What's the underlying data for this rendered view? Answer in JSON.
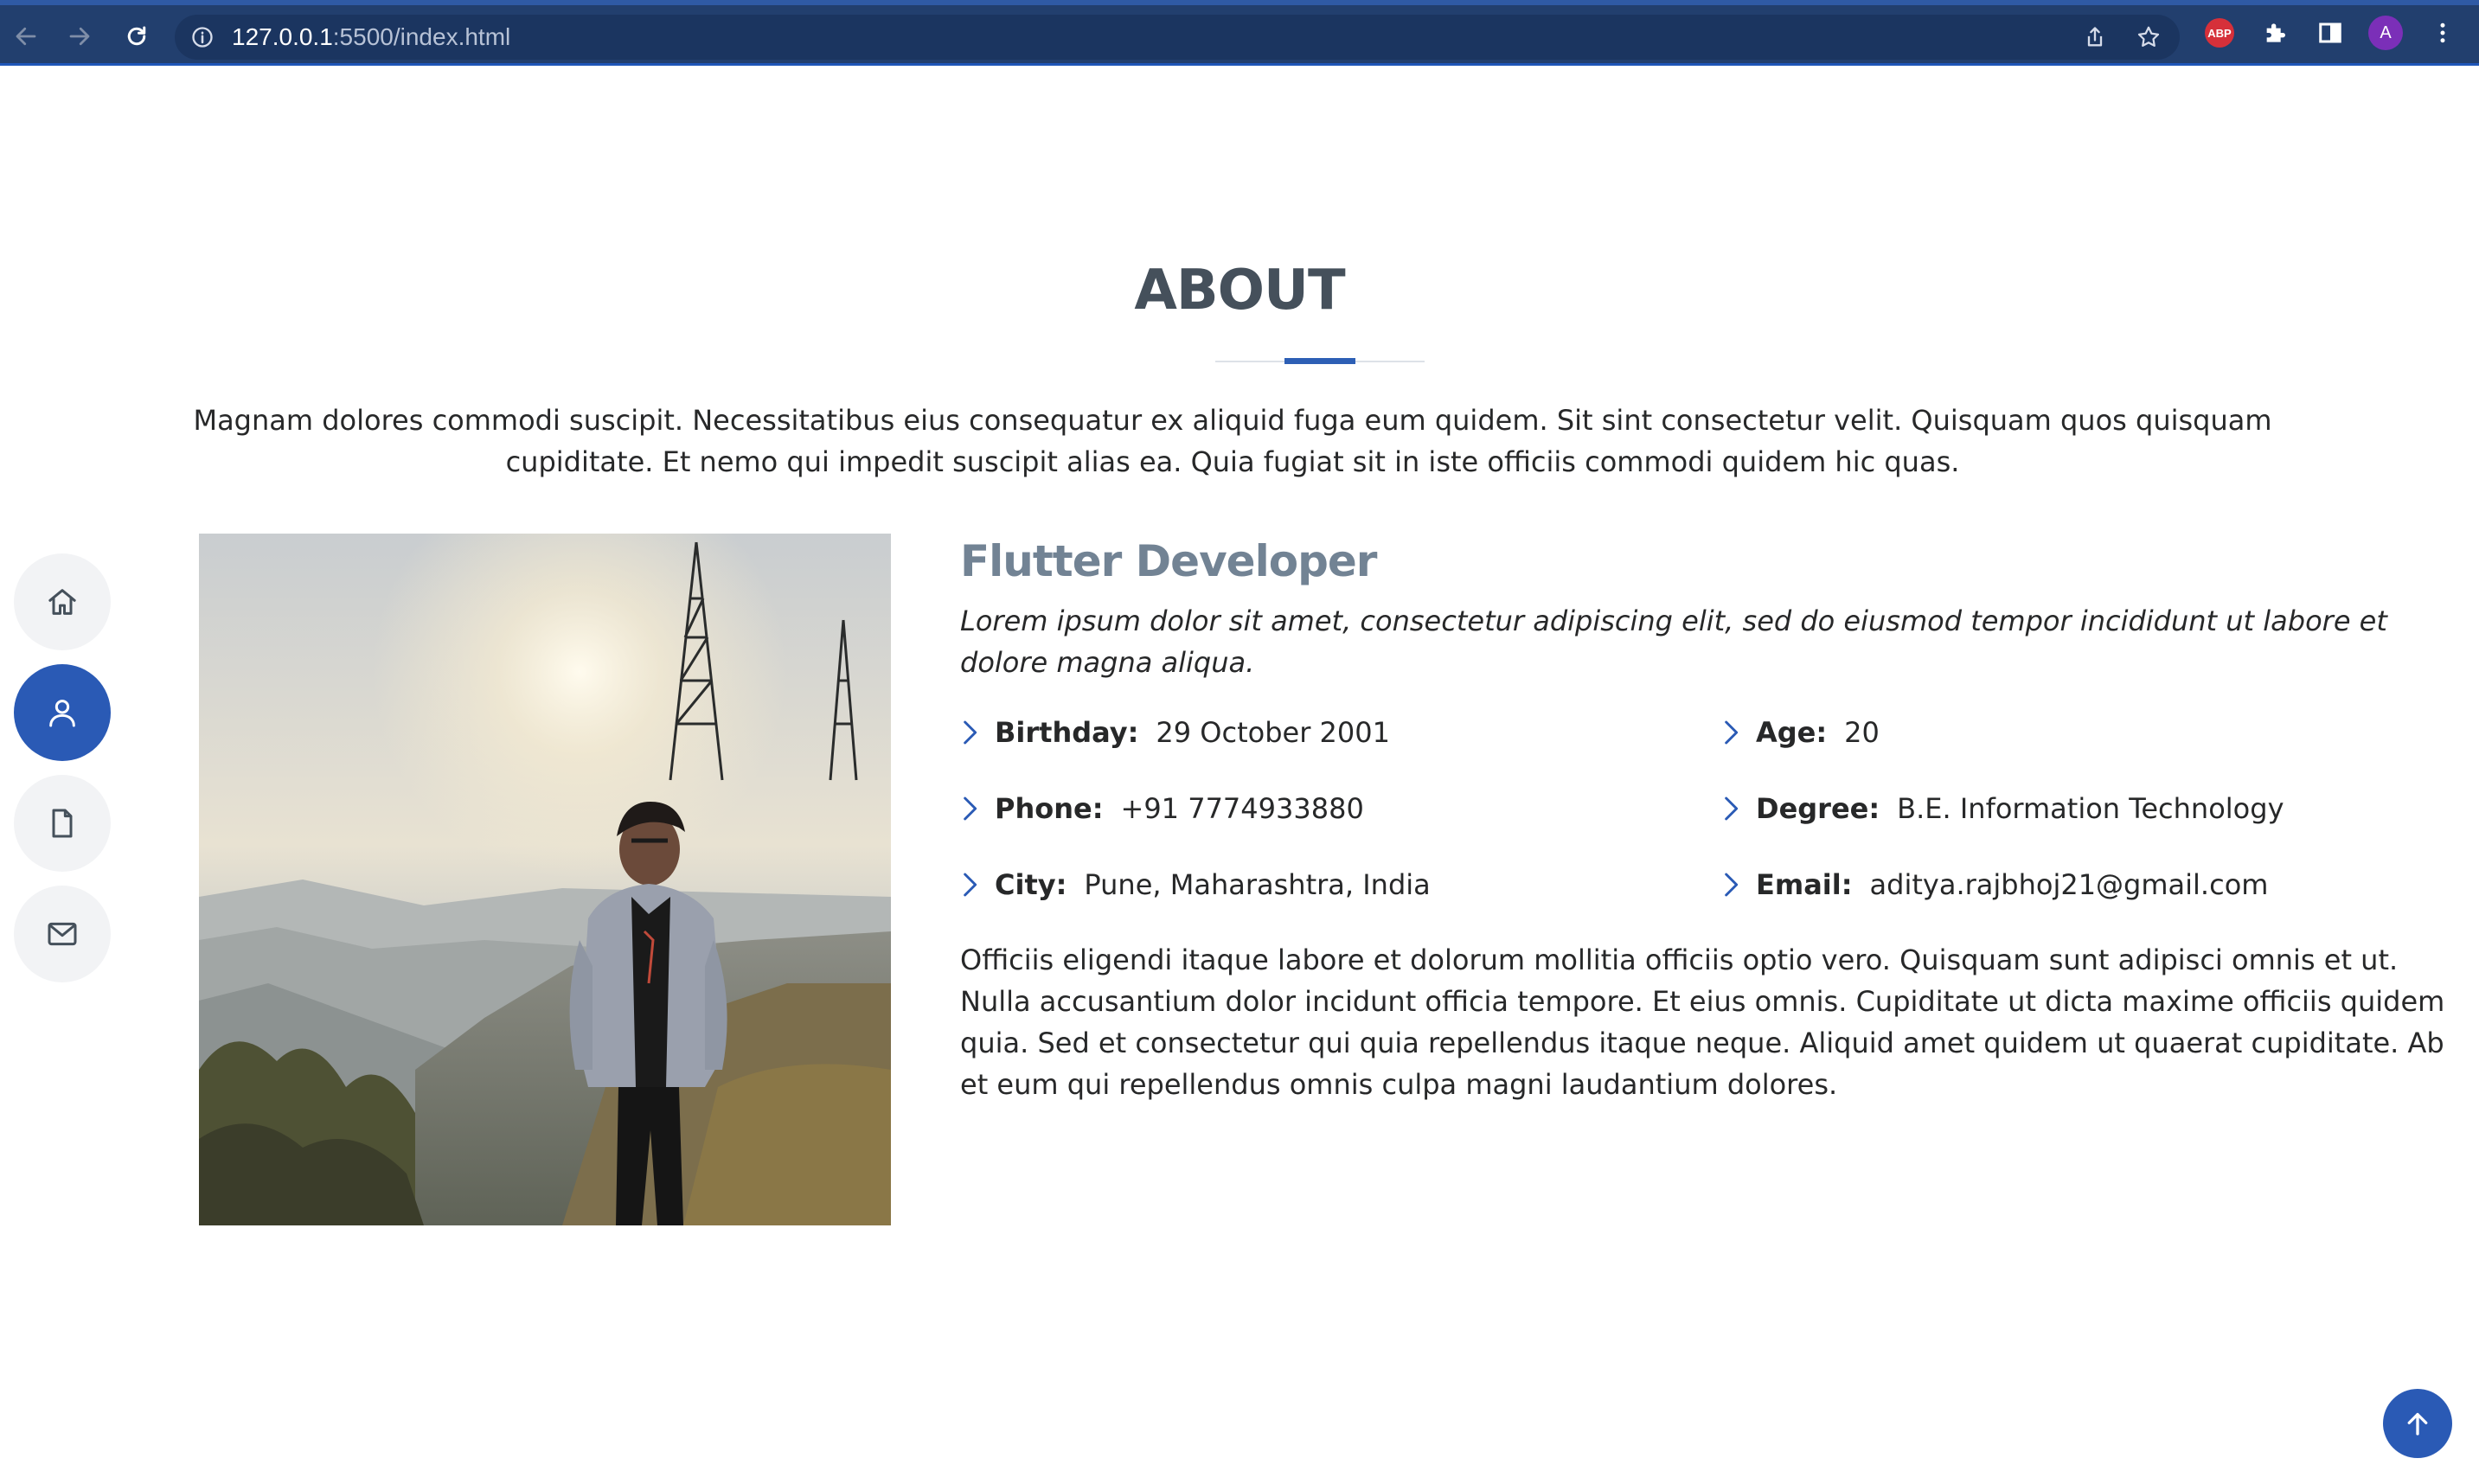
{
  "browser": {
    "url_host": "127.0.0.1",
    "url_rest": ":5500/index.html",
    "profile_initial": "A",
    "adblock_label": "ABP"
  },
  "section": {
    "title": "ABOUT",
    "intro": "Magnam dolores commodi suscipit. Necessitatibus eius consequatur ex aliquid fuga eum quidem. Sit sint consectetur velit. Quisquam quos quisquam cupiditate. Et nemo qui impedit suscipit alias ea. Quia fugiat sit in iste officiis commodi quidem hic quas."
  },
  "sidenav": {
    "items": [
      {
        "icon": "home-icon",
        "active": false
      },
      {
        "icon": "user-icon",
        "active": true
      },
      {
        "icon": "file-icon",
        "active": false
      },
      {
        "icon": "mail-icon",
        "active": false
      }
    ]
  },
  "profile": {
    "role": "Flutter Developer",
    "tagline": "Lorem ipsum dolor sit amet, consectetur adipiscing elit, sed do eiusmod tempor incididunt ut labore et dolore magna aliqua.",
    "birthday_label": "Birthday:",
    "birthday": "29 October 2001",
    "age_label": "Age:",
    "age": "20",
    "phone_label": "Phone:",
    "phone": "+91 7774933880",
    "degree_label": "Degree:",
    "degree": "B.E. Information Technology",
    "city_label": "City:",
    "city": "Pune, Maharashtra, India",
    "email_label": "Email:",
    "email": "aditya.rajbhoj21@gmail.com",
    "bio": "Officiis eligendi itaque labore et dolorum mollitia officiis optio vero. Quisquam sunt adipisci omnis et ut. Nulla accusantium dolor incidunt officia tempore. Et eius omnis. Cupiditate ut dicta maxime officiis quidem quia. Sed et consectetur qui quia repellendus itaque neque. Aliquid amet quidem ut quaerat cupiditate. Ab et eum qui repellendus omnis culpa magni laudantium dolores."
  },
  "colors": {
    "accent": "#2a5ab5",
    "heading": "#45505b",
    "role": "#728394",
    "text": "#272829"
  }
}
